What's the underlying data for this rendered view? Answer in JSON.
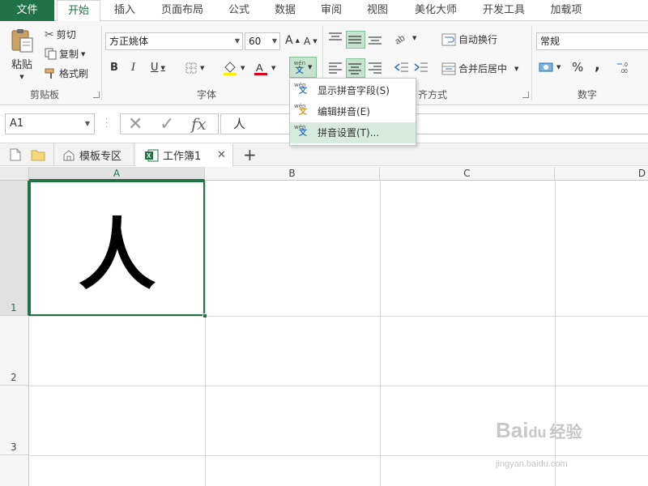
{
  "menu": {
    "tabs": [
      "文件",
      "开始",
      "插入",
      "页面布局",
      "公式",
      "数据",
      "审阅",
      "视图",
      "美化大师",
      "开发工具",
      "加载项"
    ],
    "active": "开始"
  },
  "ribbon": {
    "clipboard": {
      "paste": "粘贴",
      "cut": "剪切",
      "copy": "复制",
      "format_painter": "格式刷",
      "group": "剪贴板"
    },
    "font": {
      "name": "方正姚体",
      "size": "60",
      "grow": "A",
      "shrink": "A",
      "bold": "B",
      "italic": "I",
      "underline": "U",
      "group": "字体"
    },
    "alignment": {
      "wrap": "自动换行",
      "merge": "合并后居中",
      "group_partial": "齐方式"
    },
    "number": {
      "format": "常规",
      "percent": "%",
      "comma": ",",
      "group": "数字"
    },
    "phonetic_icon_top": "wén",
    "phonetic_icon_bottom": "文"
  },
  "phonetic_menu": [
    {
      "label": "显示拼音字段(S)",
      "selected": false
    },
    {
      "label": "编辑拼音(E)",
      "selected": false
    },
    {
      "label": "拼音设置(T)...",
      "selected": true
    }
  ],
  "formula_bar": {
    "name_box": "A1",
    "cancel": "✕",
    "enter": "✓",
    "fx": "fx",
    "content": "人"
  },
  "sheet_tabs": {
    "template_zone": "模板专区",
    "workbook": "工作簿1",
    "close": "✕",
    "add": "+"
  },
  "grid": {
    "columns": [
      "A",
      "B",
      "C",
      "D"
    ],
    "rows": [
      "1",
      "2",
      "3"
    ],
    "selected_cell": "A1",
    "cell_a1": "人"
  },
  "watermark": {
    "brand": "Bai",
    "brand2": "经验",
    "url": "jingyan.baidu.com"
  },
  "colors": {
    "accent": "#217346",
    "highlight": "#d6ebdd"
  }
}
